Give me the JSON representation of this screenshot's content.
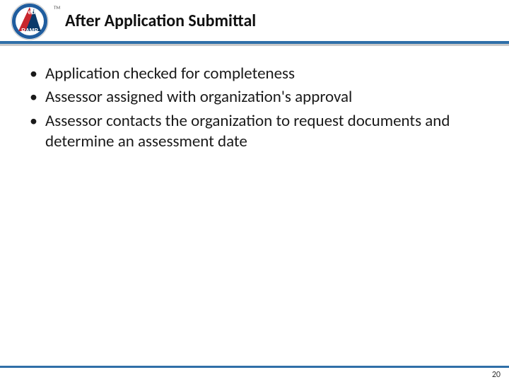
{
  "header": {
    "title": "After Application Submittal",
    "logo_text_top": "Fed",
    "logo_text_bottom": "RAMP",
    "tm": "TM"
  },
  "bullets": [
    "Application checked for completeness",
    "Assessor assigned with organization's approval",
    "Assessor contacts the organization to request documents and determine an assessment date"
  ],
  "footer": {
    "page_number": "20"
  }
}
